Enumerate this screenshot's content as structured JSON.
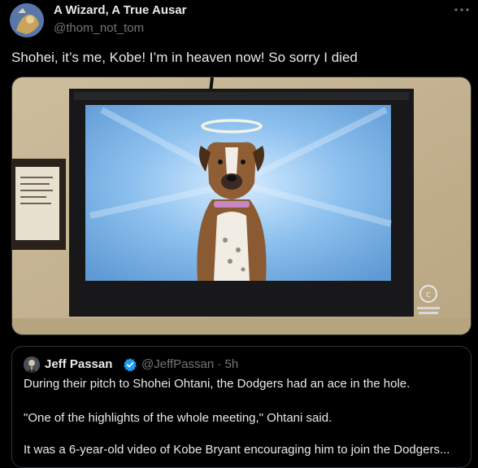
{
  "author": {
    "display_name": "A Wizard, A True Ausar",
    "handle": "@thom_not_tom"
  },
  "more_icon": "ellipsis-icon",
  "tweet": {
    "text": "Shohei, it’s me, Kobe! I’m in heaven now! So sorry I died"
  },
  "media": {
    "description_icon": "tv-photo",
    "colors": {
      "wall": "#c8b89a",
      "tv_bezel": "#1a1a1c",
      "screen_sky": "#7fb2e2",
      "dog_fur": "#8a5a32"
    }
  },
  "quoted": {
    "name": "Jeff Passan",
    "verified_icon": "verified-badge-icon",
    "meta": "@JeffPassan · 5h",
    "line1": "During their pitch to Shohei Ohtani, the Dodgers had an ace in the hole.",
    "line2": "\"One of the highlights of the whole meeting,\" Ohtani said.",
    "line3": "It was a 6-year-old video of Kobe Bryant encouraging him to join the Dodgers..."
  },
  "colors": {
    "background": "#000000",
    "text_primary": "#e7e9ea",
    "text_secondary": "#71767b",
    "border": "#2f3336",
    "verified_blue": "#1d9bf0"
  }
}
